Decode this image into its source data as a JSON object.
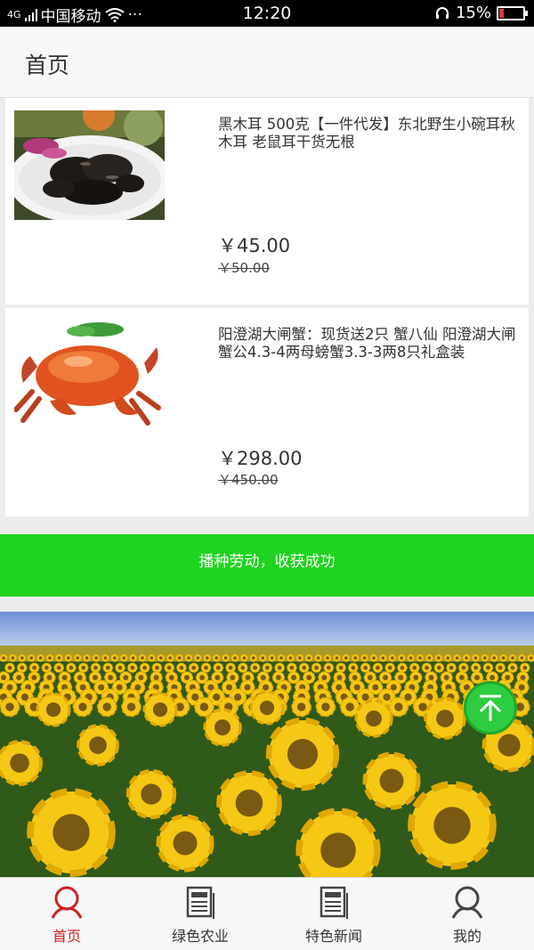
{
  "status_bar": {
    "carrier": "中国移动",
    "network": "4G",
    "more": "···",
    "time": "12:20",
    "battery": "15%"
  },
  "header": {
    "title": "首页"
  },
  "products": [
    {
      "name": "黑木耳 500克【一件代发】东北野生小碗耳秋木耳 老鼠耳干货无根",
      "price": "￥45.00",
      "old_price": "￥50.00",
      "image_icon": "black-fungus-dish-image"
    },
    {
      "name": "阳澄湖大闸蟹：现货送2只 蟹八仙 阳澄湖大闸蟹公4.3-4两母螃蟹3.3-3两8只礼盒装",
      "price": "￥298.00",
      "old_price": "￥450.00",
      "image_icon": "hairy-crab-image"
    }
  ],
  "banner": {
    "text": "播种劳动，收获成功"
  },
  "bottom_nav": {
    "items": [
      {
        "label": "首页",
        "icon": "person-icon",
        "active": true
      },
      {
        "label": "绿色农业",
        "icon": "newspaper-icon",
        "active": false
      },
      {
        "label": "特色新闻",
        "icon": "newspaper-icon",
        "active": false
      },
      {
        "label": "我的",
        "icon": "person-icon",
        "active": false
      }
    ]
  },
  "colors": {
    "accent_green": "#1fd41f",
    "active_red": "#cc2222",
    "status_bar": "#000000"
  }
}
